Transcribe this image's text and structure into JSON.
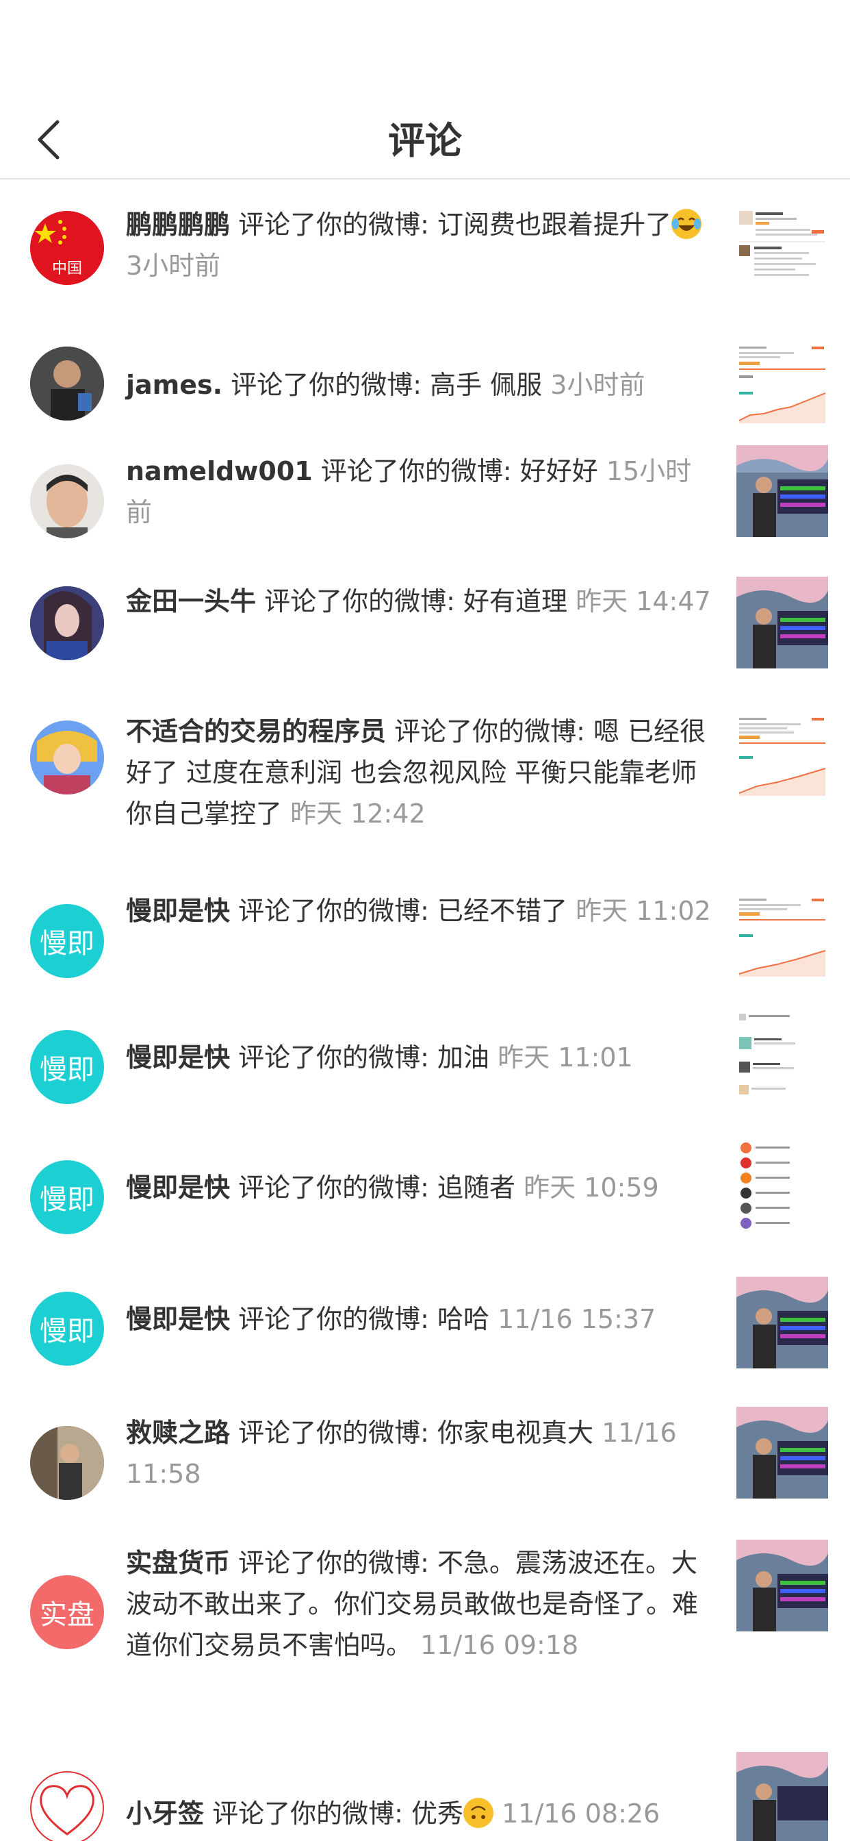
{
  "header": {
    "title": "评论"
  },
  "comments": [
    {
      "user": "鹏鹏鹏鹏",
      "action": "评论了你的微博:",
      "text": "订阅费也跟着提升了",
      "emoji": "laughing-tears",
      "time": "3小时前",
      "avatar_text": "中国",
      "avatar_color": "#e0141e"
    },
    {
      "user": "james.",
      "action": "评论了你的微博:",
      "text": "高手 佩服",
      "time": "3小时前"
    },
    {
      "user": "nameldw001",
      "action": "评论了你的微博:",
      "text": "好好好",
      "time": "15小时前"
    },
    {
      "user": "金田一头牛",
      "action": "评论了你的微博:",
      "text": "好有道理",
      "time": "昨天 14:47"
    },
    {
      "user": "不适合的交易的程序员",
      "action": "评论了你的微博:",
      "text": "嗯 已经很好了 过度在意利润 也会忽视风险 平衡只能靠老师你自己掌控了",
      "time": "昨天 12:42"
    },
    {
      "user": "慢即是快",
      "action": "评论了你的微博:",
      "text": "已经不错了",
      "time": "昨天 11:02",
      "avatar_text": "慢即",
      "avatar_color": "#1ccfd3"
    },
    {
      "user": "慢即是快",
      "action": "评论了你的微博:",
      "text": "加油",
      "time": "昨天 11:01",
      "avatar_text": "慢即",
      "avatar_color": "#1ccfd3"
    },
    {
      "user": "慢即是快",
      "action": "评论了你的微博:",
      "text": "追随者",
      "time": "昨天 10:59",
      "avatar_text": "慢即",
      "avatar_color": "#1ccfd3"
    },
    {
      "user": "慢即是快",
      "action": "评论了你的微博:",
      "text": "哈哈",
      "time": "11/16 15:37",
      "avatar_text": "慢即",
      "avatar_color": "#1ccfd3"
    },
    {
      "user": "救赎之路",
      "action": "评论了你的微博:",
      "text": "你家电视真大",
      "time": "11/16 11:58"
    },
    {
      "user": "实盘货币",
      "action": "评论了你的微博:",
      "text": "不急。震荡波还在。大波动不敢出来了。你们交易员敢做也是奇怪了。难道你们交易员不害怕吗。",
      "time": "11/16 09:18",
      "avatar_text": "实盘",
      "avatar_color": "#f26a6a"
    },
    {
      "user": "小牙签",
      "action": "评论了你的微博:",
      "text": "优秀",
      "emoji": "upside-down-face",
      "time": "11/16 08:26"
    }
  ]
}
